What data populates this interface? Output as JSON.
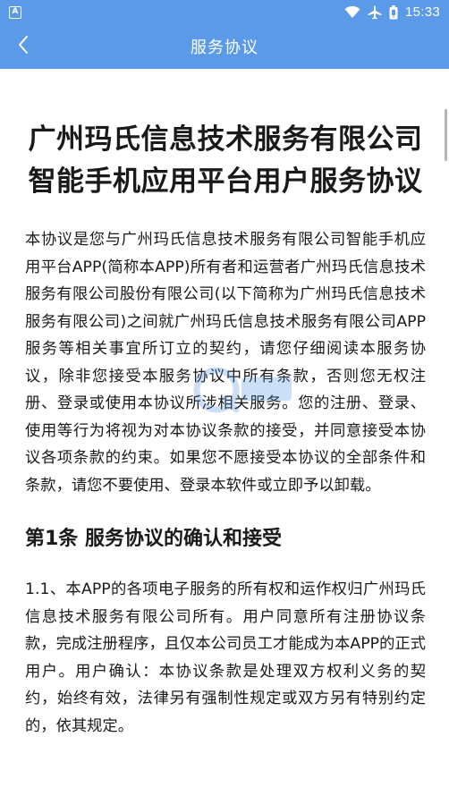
{
  "status_bar": {
    "time": "15:33",
    "left_icon": "app-notification-icon",
    "right_icons": [
      "wifi-icon",
      "airplane-icon",
      "battery-icon"
    ]
  },
  "app_bar": {
    "title": "服务协议",
    "back_icon": "chevron-left-icon"
  },
  "document": {
    "title": "广州玛氏信息技术服务有限公司智能手机应用平台用户服务协议",
    "intro": "本协议是您与广州玛氏信息技术服务有限公司智能手机应用平台APP(简称本APP)所有者和运营者广州玛氏信息技术服务有限公司股份有限公司(以下简称为广州玛氏信息技术服务有限公司)之间就广州玛氏信息技术服务有限公司APP服务等相关事宜所订立的契约，请您仔细阅读本服务协议，除非您接受本服务协议中所有条款，否则您无权注册、登录或使用本协议所涉相关服务。您的注册、登录、使用等行为将视为对本协议条款的接受，并同意接受本协议各项条款的约束。如果您不愿接受本协议的全部条件和条款，请您不要使用、登录本软件或立即予以卸载。",
    "section1_heading": "第1条 服务协议的确认和接受",
    "clause_1_1": "1.1、本APP的各项电子服务的所有权和运作权归广州玛氏信息技术服务有限公司所有。用户同意所有注册协议条款，完成注册程序，且仅本公司员工才能成为本APP的正式用户。用户确认：本协议条款是处理双方权利义务的契约，始终有效，法律另有强制性规定或双方另有特别约定的，依其规定。"
  },
  "colors": {
    "accent": "#5b9ae8",
    "text": "#1a1a1a",
    "background": "#ffffff"
  }
}
